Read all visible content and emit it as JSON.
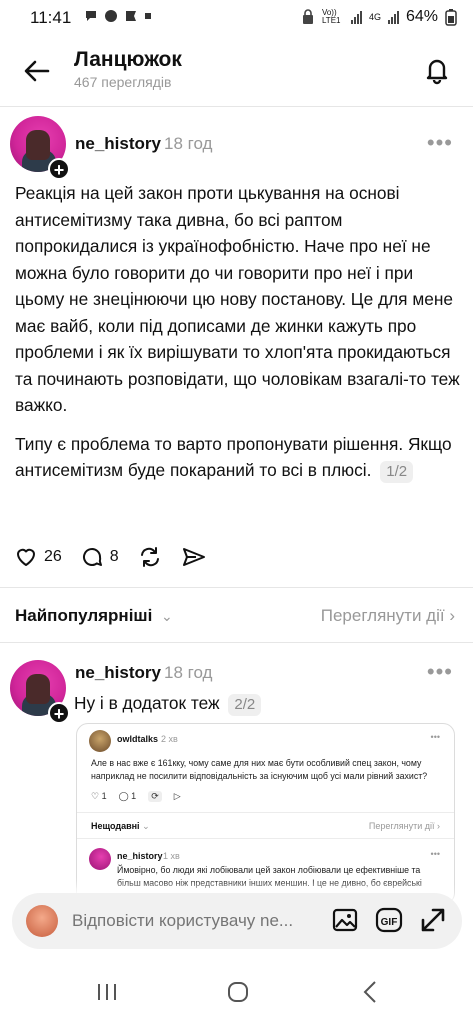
{
  "status_bar": {
    "time": "11:41",
    "battery": "64%",
    "network": "Vo)) LTE1",
    "generation": "4G"
  },
  "header": {
    "title": "Ланцюжок",
    "subtitle": "467 переглядів"
  },
  "post1": {
    "username": "ne_history",
    "time": "18 год",
    "paragraph1": "Реакція на цей закон проти цькування на основі антисемітизму така дивна, бо всі раптом попрокидалися із українофобністю. Наче про неї не можна було говорити до чи говорити про неї і при цьому не знецінюючи цю нову постанову. Це для мене має вайб, коли під дописами де жинки кажуть про проблеми і як їх вирішувати то хлоп'ята прокидаються та починають розповідати, що чоловікам взагалі-то теж важко.",
    "paragraph2": "Типу є проблема то варто пропонувати рішення. Якщо антисемітизм буде покараний то всі в плюсі.",
    "page_badge": "1/2",
    "likes": "26",
    "comments": "8"
  },
  "sort": {
    "label": "Найпопулярніші",
    "activity": "Переглянути дії"
  },
  "post2": {
    "username": "ne_history",
    "time": "18 год",
    "text": "Ну і в додаток теж",
    "page_badge": "2/2"
  },
  "embed": {
    "user1": "owldtalks",
    "time1": "2 хв",
    "text1": "Але в нас вже є 161кку, чому саме для них має бути особливий спец закон, чому наприклад не посилити відповідальність за існуючим щоб усі мали рівний захист?",
    "likes": "1",
    "comments": "1",
    "sort_label": "Нещодавні",
    "activity": "Переглянути дії",
    "user2": "ne_history",
    "time2": "1 хв",
    "text2": "Ймовірно, бо люди які лобіювали цей закон лобіювали це ефективніше та більш масово ніж представники інших меншин. І це не дивно, бо єврейські"
  },
  "reply_bar": {
    "placeholder": "Відповісти користувачу ne..."
  },
  "icons": [
    "back-arrow-icon",
    "bell-icon",
    "more-icon",
    "heart-icon",
    "comment-icon",
    "repost-icon",
    "share-icon",
    "chevron-down-icon",
    "chevron-right-icon",
    "image-icon",
    "gif-icon",
    "expand-icon",
    "recent-apps-icon",
    "home-icon",
    "back-nav-icon"
  ]
}
